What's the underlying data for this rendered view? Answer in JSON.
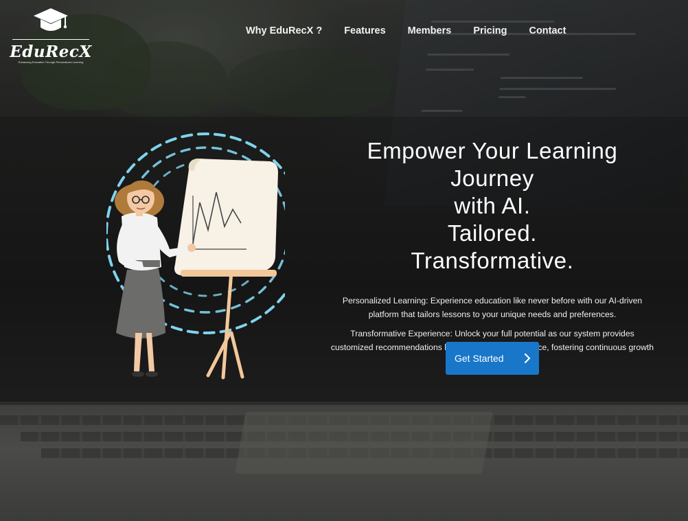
{
  "brand": {
    "name": "EduRecX",
    "tagline": "Enhancing Education Through Personalized Learning"
  },
  "nav": {
    "items": [
      {
        "label": "Why EduRecX ?"
      },
      {
        "label": "Features"
      },
      {
        "label": "Members"
      },
      {
        "label": "Pricing"
      },
      {
        "label": "Contact"
      }
    ]
  },
  "hero": {
    "headline_line1": "Empower Your Learning Journey",
    "headline_line2": "with AI.",
    "headline_line3": "Tailored.",
    "headline_line4": "Transformative.",
    "paragraph1": "Personalized Learning: Experience education like never before with our AI-driven platform that tailors lessons to your unique needs and preferences.",
    "paragraph2": "Transformative Experience: Unlock your full potential as our system provides customized recommendations based on your performance, fostering continuous growth and achievement",
    "cta_label": "Get Started",
    "cta_icon": "chevron-right-icon"
  },
  "colors": {
    "accent": "#1877c9",
    "ring": "#7fd3ef",
    "text": "#ffffff"
  }
}
